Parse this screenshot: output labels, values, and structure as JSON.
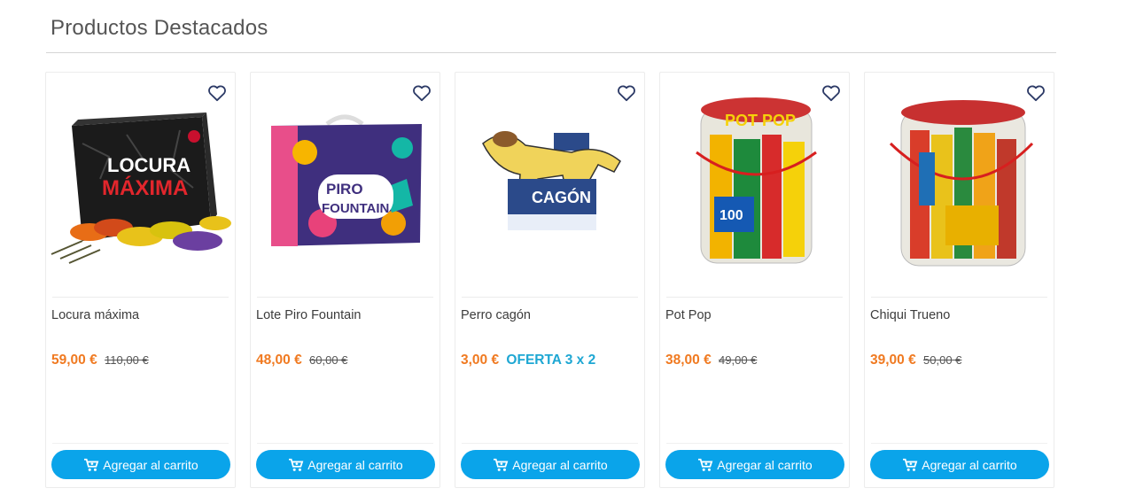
{
  "section": {
    "title": "Productos Destacados"
  },
  "colors": {
    "price": "#f07a21",
    "offer": "#1ea7d3",
    "button": "#0aa4ea",
    "heart": "#2c3a66"
  },
  "products": [
    {
      "name": "Locura máxima",
      "price": "59,00 €",
      "old_price": "110,00 €",
      "offer": "",
      "button_label": "Agregar al carrito",
      "image_label": "LOCURA MÁXIMA"
    },
    {
      "name": "Lote Piro Fountain",
      "price": "48,00 €",
      "old_price": "60,00 €",
      "offer": "",
      "button_label": "Agregar al carrito",
      "image_label": "PIRO FOUNTAIN"
    },
    {
      "name": "Perro cagón",
      "price": "3,00 €",
      "old_price": "",
      "offer": "OFERTA 3 x 2",
      "button_label": "Agregar al carrito",
      "image_label": "CAGÓN"
    },
    {
      "name": "Pot Pop",
      "price": "38,00 €",
      "old_price": "49,00 €",
      "offer": "",
      "button_label": "Agregar al carrito",
      "image_label": "POT POP"
    },
    {
      "name": "Chiqui Trueno",
      "price": "39,00 €",
      "old_price": "50,00 €",
      "offer": "",
      "button_label": "Agregar al carrito",
      "image_label": ""
    }
  ]
}
